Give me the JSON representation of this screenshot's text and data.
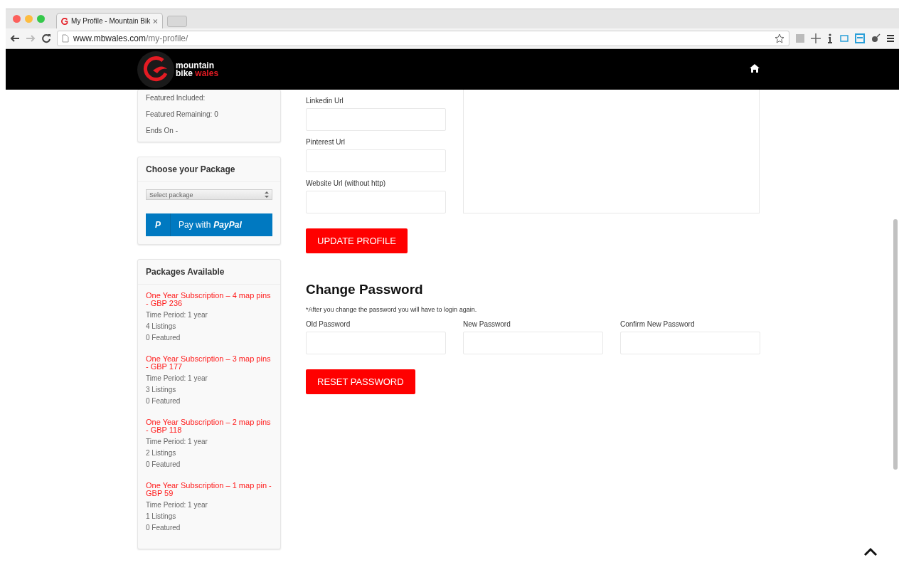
{
  "browser": {
    "tab_title": "My Profile - Mountain Bik",
    "url_host": "www.mbwales.com",
    "url_path": "/my-profile/"
  },
  "header": {
    "logo_line1": "mountain",
    "logo_line2": "bike",
    "logo_line2_accent": "wales"
  },
  "sidebar": {
    "account_lines": [
      "Featured Included:",
      "Featured Remaining: 0",
      "Ends On -"
    ],
    "package_card": {
      "title": "Choose your Package",
      "select_placeholder": "Select package",
      "paypal_mark": "P",
      "paypal_label": "Pay with **PayPal**"
    },
    "packages": {
      "title": "Packages Available",
      "items": [
        {
          "name": "One Year Subscription – 4 map pins - GBP 236",
          "period": "Time Period: 1 year",
          "listings": "4 Listings",
          "featured": "0 Featured"
        },
        {
          "name": "One Year Subscription – 3 map pins - GBP 177",
          "period": "Time Period: 1 year",
          "listings": "3 Listings",
          "featured": "0 Featured"
        },
        {
          "name": "One Year Subscription – 2 map pins - GBP 118",
          "period": "Time Period: 1 year",
          "listings": "2 Listings",
          "featured": "0 Featured"
        },
        {
          "name": "One Year Subscription – 1 map pin - GBP 59",
          "period": "Time Period: 1 year",
          "listings": "1 Listings",
          "featured": "0 Featured"
        }
      ]
    }
  },
  "profile_form": {
    "fields": [
      {
        "label": "Linkedin Url"
      },
      {
        "label": "Pinterest Url"
      },
      {
        "label": "Website Url (without http)"
      }
    ],
    "button": "UPDATE PROFILE"
  },
  "change_password": {
    "title": "Change Password",
    "note": "*After you change the password you will have to login again.",
    "fields": [
      {
        "label": "Old Password"
      },
      {
        "label": "New Password"
      },
      {
        "label": "Confirm New Password"
      }
    ],
    "button": "RESET PASSWORD"
  }
}
